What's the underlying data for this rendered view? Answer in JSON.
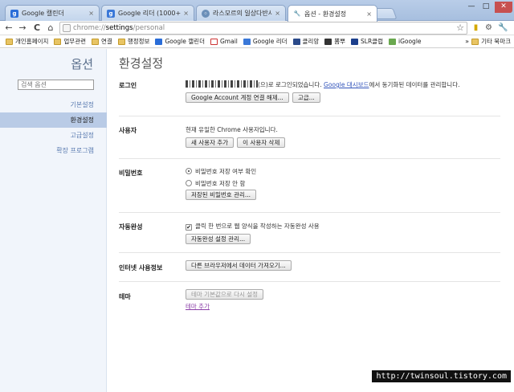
{
  "tabs": [
    {
      "title": "Google 캘린더",
      "icon": "google-calendar-icon",
      "color": "#2a6dd8"
    },
    {
      "title": "Google 리더 (1000+)",
      "icon": "google-reader-icon",
      "color": "#3a78d8"
    },
    {
      "title": "라스모르의 일상다반사 ::",
      "icon": "globe-icon",
      "color": "#6b8fb8"
    },
    {
      "title": "옵션 - 환경설정",
      "icon": "wrench-icon",
      "color": "#777777"
    }
  ],
  "window": {
    "minimize": "—",
    "maximize": "□",
    "close": "✕"
  },
  "toolbar": {
    "back": "←",
    "forward": "→",
    "reload": "C",
    "home": "⌂",
    "url_scheme": "chrome://",
    "url_host": "settings",
    "url_path": "/personal",
    "star": "☆"
  },
  "bookmarks": [
    {
      "label": "개인홈페이지",
      "icon": "folder-icon"
    },
    {
      "label": "업무관련",
      "icon": "folder-icon"
    },
    {
      "label": "연결",
      "icon": "folder-icon"
    },
    {
      "label": "행정정보",
      "icon": "folder-icon"
    },
    {
      "label": "Google 캘린더",
      "icon": "google-calendar-icon"
    },
    {
      "label": "Gmail",
      "icon": "gmail-icon"
    },
    {
      "label": "Google 리더",
      "icon": "google-reader-icon"
    },
    {
      "label": "클리앙",
      "icon": "clien-icon"
    },
    {
      "label": "뽐뿌",
      "icon": "ppomppu-icon"
    },
    {
      "label": "SLR클럽",
      "icon": "slr-icon"
    },
    {
      "label": "iGoogle",
      "icon": "igoogle-icon"
    }
  ],
  "bookmarks_more": "»",
  "bookmarks_other": "기타 북마크",
  "sidebar": {
    "title": "옵션",
    "search_placeholder": "검색 옵션",
    "items": [
      {
        "label": "기본설정",
        "selected": false
      },
      {
        "label": "환경설정",
        "selected": true
      },
      {
        "label": "고급설정",
        "selected": false
      },
      {
        "label": "확장 프로그램",
        "selected": false
      }
    ]
  },
  "main": {
    "title": "환경설정",
    "login": {
      "label": "로그인",
      "text_after_email": "(으)로 로그인되었습니다.",
      "dashboard_link": "Google 대시보드",
      "text_tail": "에서 동기화된 데이터를 관리합니다.",
      "disconnect_button": "Google Account 계정 연결 해제...",
      "advanced_button": "고급..."
    },
    "users": {
      "label": "사용자",
      "text": "현재 유일한 Chrome 사용자입니다.",
      "add_button": "새 사용자 추가",
      "delete_button": "이 사용자 삭제"
    },
    "passwords": {
      "label": "비밀번호",
      "option_offer": "비밀번호 저장 여부 확인",
      "option_never": "비밀번호 저장 안 함",
      "manage_button": "저장된 비밀번호 관리..."
    },
    "autofill": {
      "label": "자동완성",
      "checkbox": "클릭 한 번으로 웹 양식을 작성하는 자동완성 사용",
      "manage_button": "자동완성 설정 관리..."
    },
    "import": {
      "label": "인터넷 사용정보",
      "import_button": "다른 브라우저에서 데이터 가져오기..."
    },
    "theme": {
      "label": "테마",
      "reset_button": "테마 기본값으로 다시 설정",
      "get_themes_link": "테마 추가"
    }
  },
  "watermark": "http://twinsoul.tistory.com"
}
